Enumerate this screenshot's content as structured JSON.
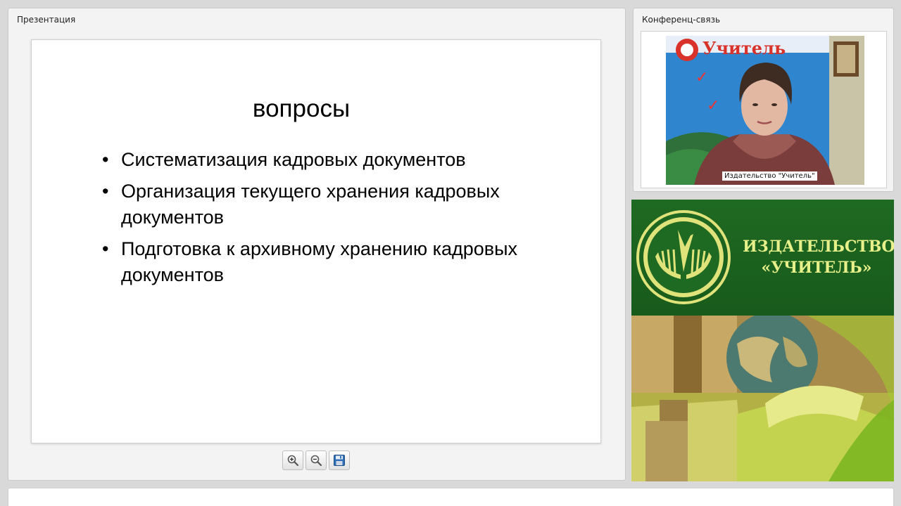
{
  "presentation": {
    "panel_title": "Презентация",
    "slide": {
      "title": "вопросы",
      "bullets": [
        "Систематизация кадровых документов",
        "Организация текущего хранения кадровых документов",
        "Подготовка к архивному хранению кадровых документов"
      ]
    },
    "toolbar": {
      "zoom_in_icon": "zoom-in-icon",
      "zoom_out_icon": "zoom-out-icon",
      "save_icon": "floppy-disk-icon"
    }
  },
  "conference": {
    "panel_title": "Конференц-связь",
    "video_caption": "Издательство \"Учитель\"",
    "backdrop_text": "Учитель"
  },
  "brand": {
    "name_line1": "ИЗДАТЕЛЬСТВО",
    "name_line2": "«УЧИТЕЛЬ»",
    "colors": {
      "green": "#1f6a22",
      "text": "#e8f08a"
    }
  }
}
